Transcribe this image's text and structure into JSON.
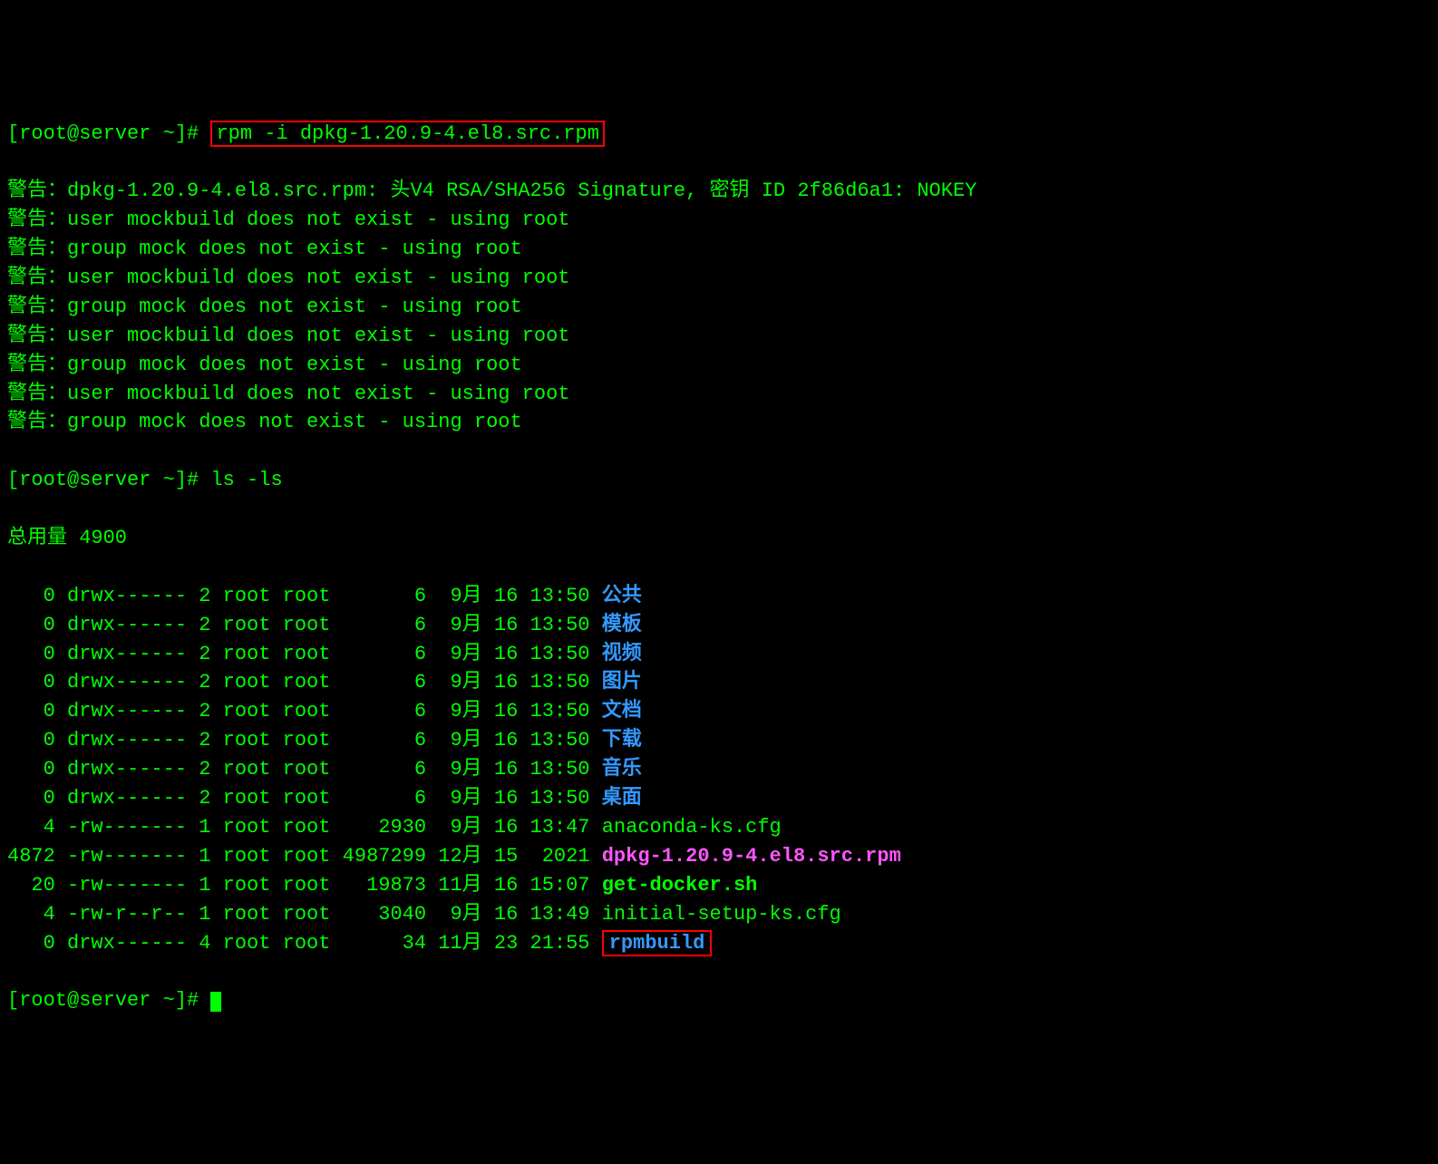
{
  "prompt1": "[root@server ~]# ",
  "cmd1": "rpm -i dpkg-1.20.9-4.el8.src.rpm",
  "warnings": [
    "警告：dpkg-1.20.9-4.el8.src.rpm: 头V4 RSA/SHA256 Signature, 密钥 ID 2f86d6a1: NOKEY",
    "警告：user mockbuild does not exist - using root",
    "警告：group mock does not exist - using root",
    "警告：user mockbuild does not exist - using root",
    "警告：group mock does not exist - using root",
    "警告：user mockbuild does not exist - using root",
    "警告：group mock does not exist - using root",
    "警告：user mockbuild does not exist - using root",
    "警告：group mock does not exist - using root"
  ],
  "prompt2": "[root@server ~]# ",
  "cmd2": "ls -ls",
  "total": "总用量 4900",
  "rows": [
    {
      "pre": "   0 drwx------ 2 root root       6  9月 16 13:50 ",
      "name": "公共",
      "cls": "dirname"
    },
    {
      "pre": "   0 drwx------ 2 root root       6  9月 16 13:50 ",
      "name": "模板",
      "cls": "dirname"
    },
    {
      "pre": "   0 drwx------ 2 root root       6  9月 16 13:50 ",
      "name": "视频",
      "cls": "dirname"
    },
    {
      "pre": "   0 drwx------ 2 root root       6  9月 16 13:50 ",
      "name": "图片",
      "cls": "dirname"
    },
    {
      "pre": "   0 drwx------ 2 root root       6  9月 16 13:50 ",
      "name": "文档",
      "cls": "dirname"
    },
    {
      "pre": "   0 drwx------ 2 root root       6  9月 16 13:50 ",
      "name": "下载",
      "cls": "dirname"
    },
    {
      "pre": "   0 drwx------ 2 root root       6  9月 16 13:50 ",
      "name": "音乐",
      "cls": "dirname"
    },
    {
      "pre": "   0 drwx------ 2 root root       6  9月 16 13:50 ",
      "name": "桌面",
      "cls": "dirname"
    },
    {
      "pre": "   4 -rw------- 1 root root    2930  9月 16 13:47 ",
      "name": "anaconda-ks.cfg",
      "cls": ""
    },
    {
      "pre": "4872 -rw------- 1 root root 4987299 12月 15  2021 ",
      "name": "dpkg-1.20.9-4.el8.src.rpm",
      "cls": "srcrpm"
    },
    {
      "pre": "  20 -rw------- 1 root root   19873 11月 16 15:07 ",
      "name": "get-docker.sh",
      "cls": "sh-file"
    },
    {
      "pre": "   4 -rw-r--r-- 1 root root    3040  9月 16 13:49 ",
      "name": "initial-setup-ks.cfg",
      "cls": ""
    },
    {
      "pre": "   0 drwx------ 4 root root      34 11月 23 21:55 ",
      "name": "rpmbuild",
      "cls": "rpmbuild-box"
    }
  ],
  "prompt3": "[root@server ~]# "
}
